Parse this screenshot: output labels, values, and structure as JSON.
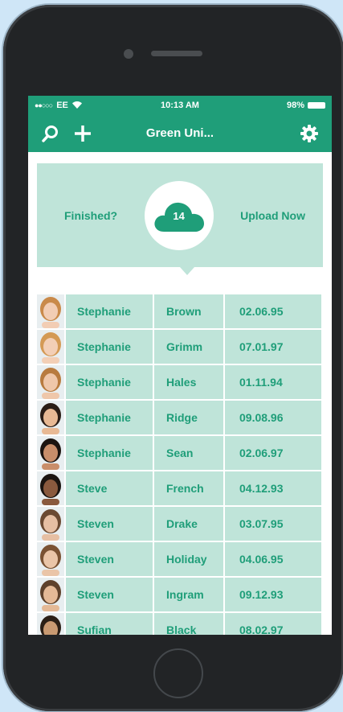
{
  "status": {
    "carrier": "EE",
    "time": "10:13 AM",
    "battery": "98%"
  },
  "nav": {
    "title": "Green Uni..."
  },
  "upload": {
    "finished_label": "Finished?",
    "count": "14",
    "upload_label": "Upload Now"
  },
  "rows": [
    {
      "first": "Stephanie",
      "last": "Brown",
      "date": "02.06.95",
      "skin": "#f2cdb4",
      "hair": "#c98a4a"
    },
    {
      "first": "Stephanie",
      "last": "Grimm",
      "date": "07.01.97",
      "skin": "#f3cfb6",
      "hair": "#d49a55"
    },
    {
      "first": "Stephanie",
      "last": "Hales",
      "date": "01.11.94",
      "skin": "#efc7aa",
      "hair": "#b87b3f"
    },
    {
      "first": "Stephanie",
      "last": "Ridge",
      "date": "09.08.96",
      "skin": "#e8b994",
      "hair": "#2a1d16"
    },
    {
      "first": "Stephanie",
      "last": "Sean",
      "date": "02.06.97",
      "skin": "#c98e6a",
      "hair": "#1c1410"
    },
    {
      "first": "Steve",
      "last": "French",
      "date": "04.12.93",
      "skin": "#8a5a3e",
      "hair": "#1a1410"
    },
    {
      "first": "Steven",
      "last": "Drake",
      "date": "03.07.95",
      "skin": "#e6bfa3",
      "hair": "#6b4a32"
    },
    {
      "first": "Steven",
      "last": "Holiday",
      "date": "04.06.95",
      "skin": "#eac5a8",
      "hair": "#7a5233"
    },
    {
      "first": "Steven",
      "last": "Ingram",
      "date": "09.12.93",
      "skin": "#e4b996",
      "hair": "#5e412b"
    },
    {
      "first": "Sufian",
      "last": "Black",
      "date": "08.02.97",
      "skin": "#c99a72",
      "hair": "#2b1f16"
    }
  ],
  "colors": {
    "accent": "#1f9e79",
    "row_bg": "#bfe4d9"
  }
}
